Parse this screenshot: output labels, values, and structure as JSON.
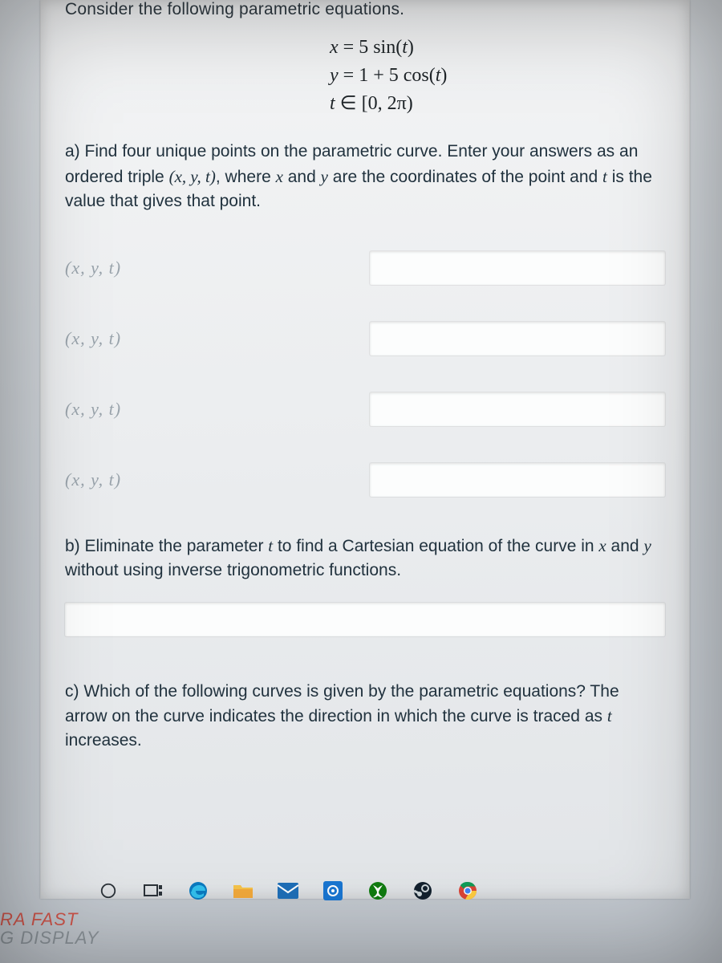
{
  "intro": "Consider the following parametric equations.",
  "equations": {
    "line1_pre": "x = 5 sin(",
    "line1_var": "t",
    "line1_post": ")",
    "line2_pre": "y = 1 + 5 cos(",
    "line2_var": "t",
    "line2_post": ")",
    "line3_var": "t",
    "line3_rest": " ∈ [0, 2π)"
  },
  "partA": {
    "lead": "a) Find four unique points on the parametric curve. Enter your answers as an ordered triple ",
    "triple": "(x, y, t)",
    "mid": ", where ",
    "x": "x",
    "and": " and ",
    "y": "y",
    "mid2": " are the coordinates of the point and ",
    "t": "t",
    "tail": " is the value that gives that point."
  },
  "row_label": "(x, y, t)",
  "rows": [
    "",
    "",
    "",
    ""
  ],
  "partB": {
    "lead": "b) Eliminate the parameter ",
    "t": "t",
    "mid": " to find a Cartesian equation of the curve in ",
    "x": "x",
    "and": " and ",
    "y": "y",
    "tail": " without using inverse trigonometric functions."
  },
  "partB_value": "",
  "partC": {
    "lead": "c) Which of the following curves is given by the parametric equations? The arrow on the curve indicates the direction in which the curve is traced as ",
    "t": "t",
    "tail": " increases."
  },
  "taskbar": {
    "cortana": "O",
    "taskview": "⊡",
    "edge": "e",
    "explorer": "folder",
    "store": "store",
    "photos": "photos",
    "xbox": "xbox",
    "steam": "steam",
    "chrome": "chrome"
  },
  "badge": {
    "line1": "RA FAST",
    "line2": "G DISPLAY"
  }
}
